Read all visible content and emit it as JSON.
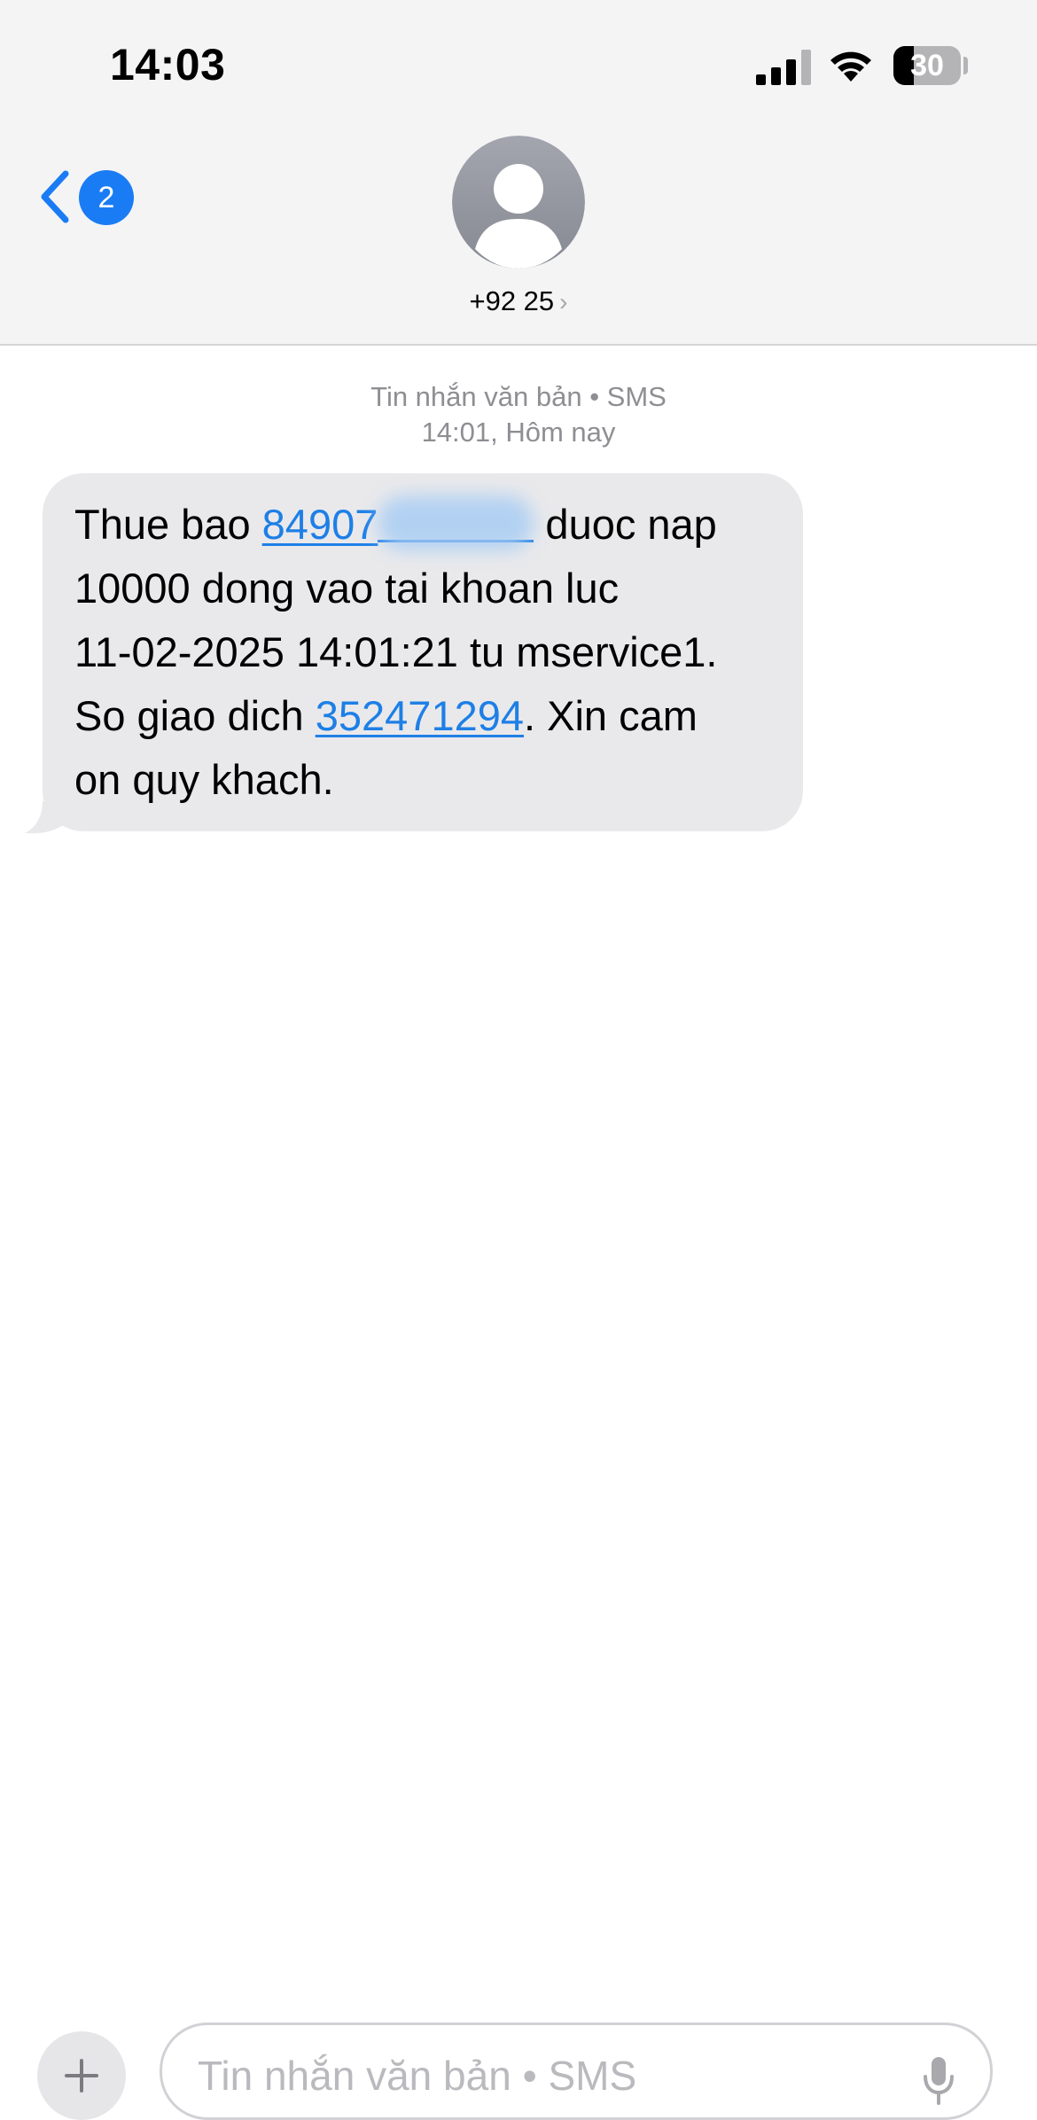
{
  "status_bar": {
    "time": "14:03",
    "battery_percent": 30,
    "battery_label": "30",
    "icons": [
      "cellular-signal-icon",
      "wifi-icon",
      "battery-icon"
    ]
  },
  "nav": {
    "unread_count": "2",
    "contact": "+92 25",
    "chevron": "›"
  },
  "thread": {
    "kind_label": "Tin nhắn văn bản • SMS",
    "timestamp": "14:01, Hôm nay"
  },
  "message": {
    "text_before": "Thue bao ",
    "phone_link": "84907",
    "text_middle": " duoc nap\n10000 dong vao tai khoan luc\n11-02-2025 14:01:21 tu mservice1.\nSo giao dich ",
    "transaction_link": "352471294",
    "text_after": ". Xin cam\non quy khach."
  },
  "composer": {
    "placeholder": "Tin nhắn văn bản • SMS"
  },
  "colors": {
    "accent": "#1a7cf5",
    "link": "#1e7fe6",
    "bubble": "#e9e9eb",
    "header_bg": "#f4f4f5",
    "secondary_text": "#8e8e93"
  }
}
